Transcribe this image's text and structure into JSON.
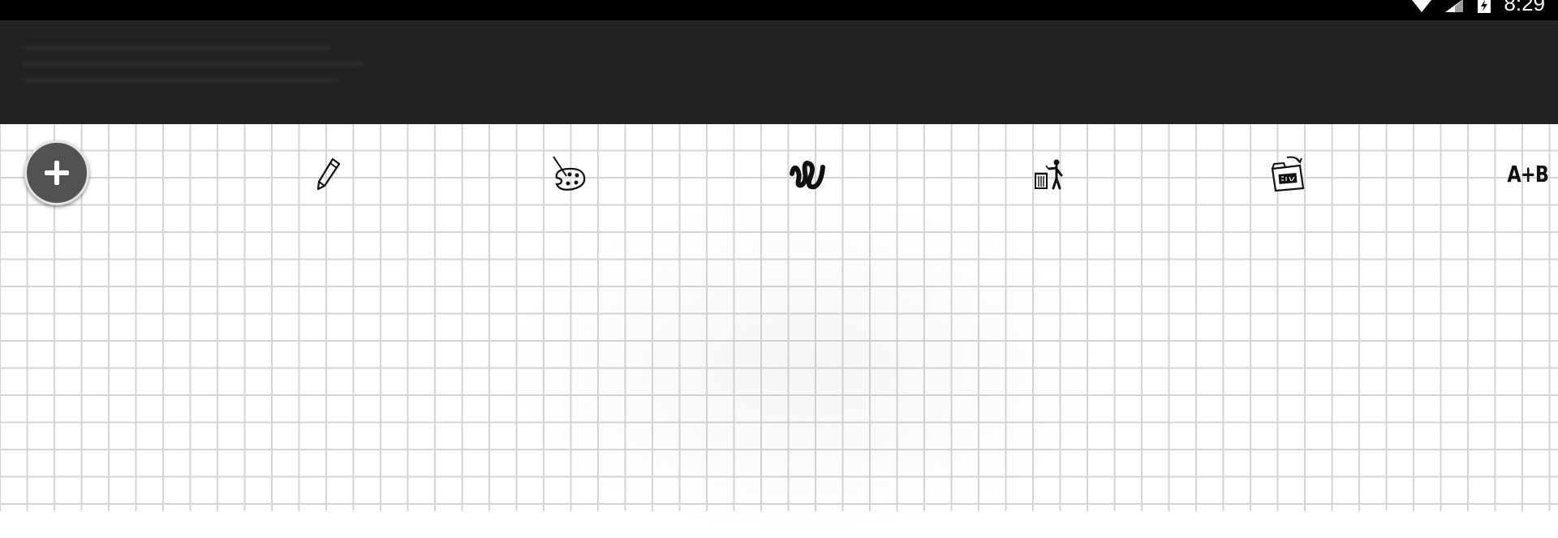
{
  "status_bar": {
    "time": "8:29",
    "icons": [
      "wifi-icon",
      "signal-icon",
      "battery-charging-icon"
    ]
  },
  "toolbar": {
    "fab": {
      "icon": "plus-icon"
    },
    "tools": [
      {
        "id": "pencil",
        "icon": "pencil-icon"
      },
      {
        "id": "palette",
        "icon": "palette-icon"
      },
      {
        "id": "stroke",
        "icon": "squiggle-brush-icon"
      },
      {
        "id": "clear",
        "icon": "trash-person-icon"
      },
      {
        "id": "save",
        "icon": "save-folder-icon"
      },
      {
        "id": "text",
        "icon": "text-icon",
        "label": "A+B"
      }
    ]
  },
  "colors": {
    "status_bar_bg": "#000000",
    "app_bar_bg": "#212121",
    "canvas_bg": "#ffffff",
    "grid_line": "#d4d4d4",
    "fab_bg": "#525252"
  }
}
